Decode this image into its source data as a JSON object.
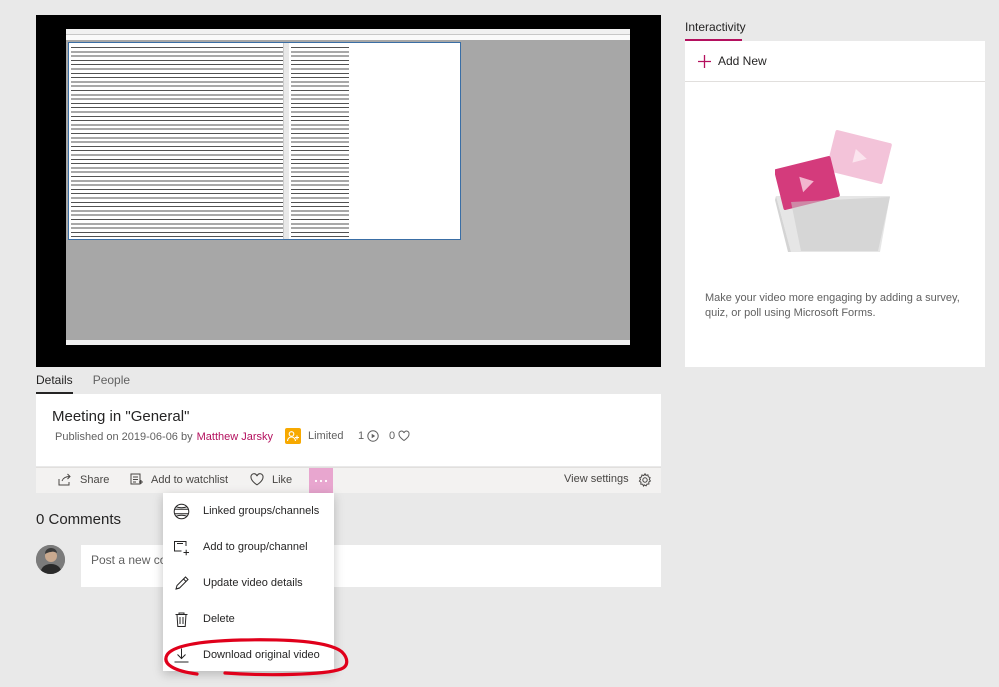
{
  "player": {},
  "tabs": [
    {
      "label": "Details"
    },
    {
      "label": "People"
    }
  ],
  "video": {
    "title": "Meeting in \"General\"",
    "published_prefix": "Published on 2019-06-06 by",
    "author": "Matthew Jarsky",
    "visibility": "Limited",
    "views": "1",
    "likes": "0"
  },
  "actions": {
    "share": "Share",
    "watchlist": "Add to watchlist",
    "like": "Like",
    "more": "...",
    "view_settings": "View settings"
  },
  "comments": {
    "header": "0 Comments",
    "placeholder": "Post a new comment"
  },
  "menu": {
    "items": [
      {
        "label": "Linked groups/channels",
        "icon": "globe-icon"
      },
      {
        "label": "Add to group/channel",
        "icon": "add-to-group-icon"
      },
      {
        "label": "Update video details",
        "icon": "pencil-icon"
      },
      {
        "label": "Delete",
        "icon": "trash-icon"
      },
      {
        "label": "Download original video",
        "icon": "download-icon"
      }
    ]
  },
  "interactivity": {
    "title": "Interactivity",
    "add_new": "Add New",
    "description": "Make your video more engaging by adding a survey, quiz, or poll using Microsoft Forms."
  },
  "colors": {
    "accent": "#b4105e",
    "more_button": "#e8a6cf",
    "limited_badge": "#f7a900",
    "annotation": "#e0001b"
  }
}
